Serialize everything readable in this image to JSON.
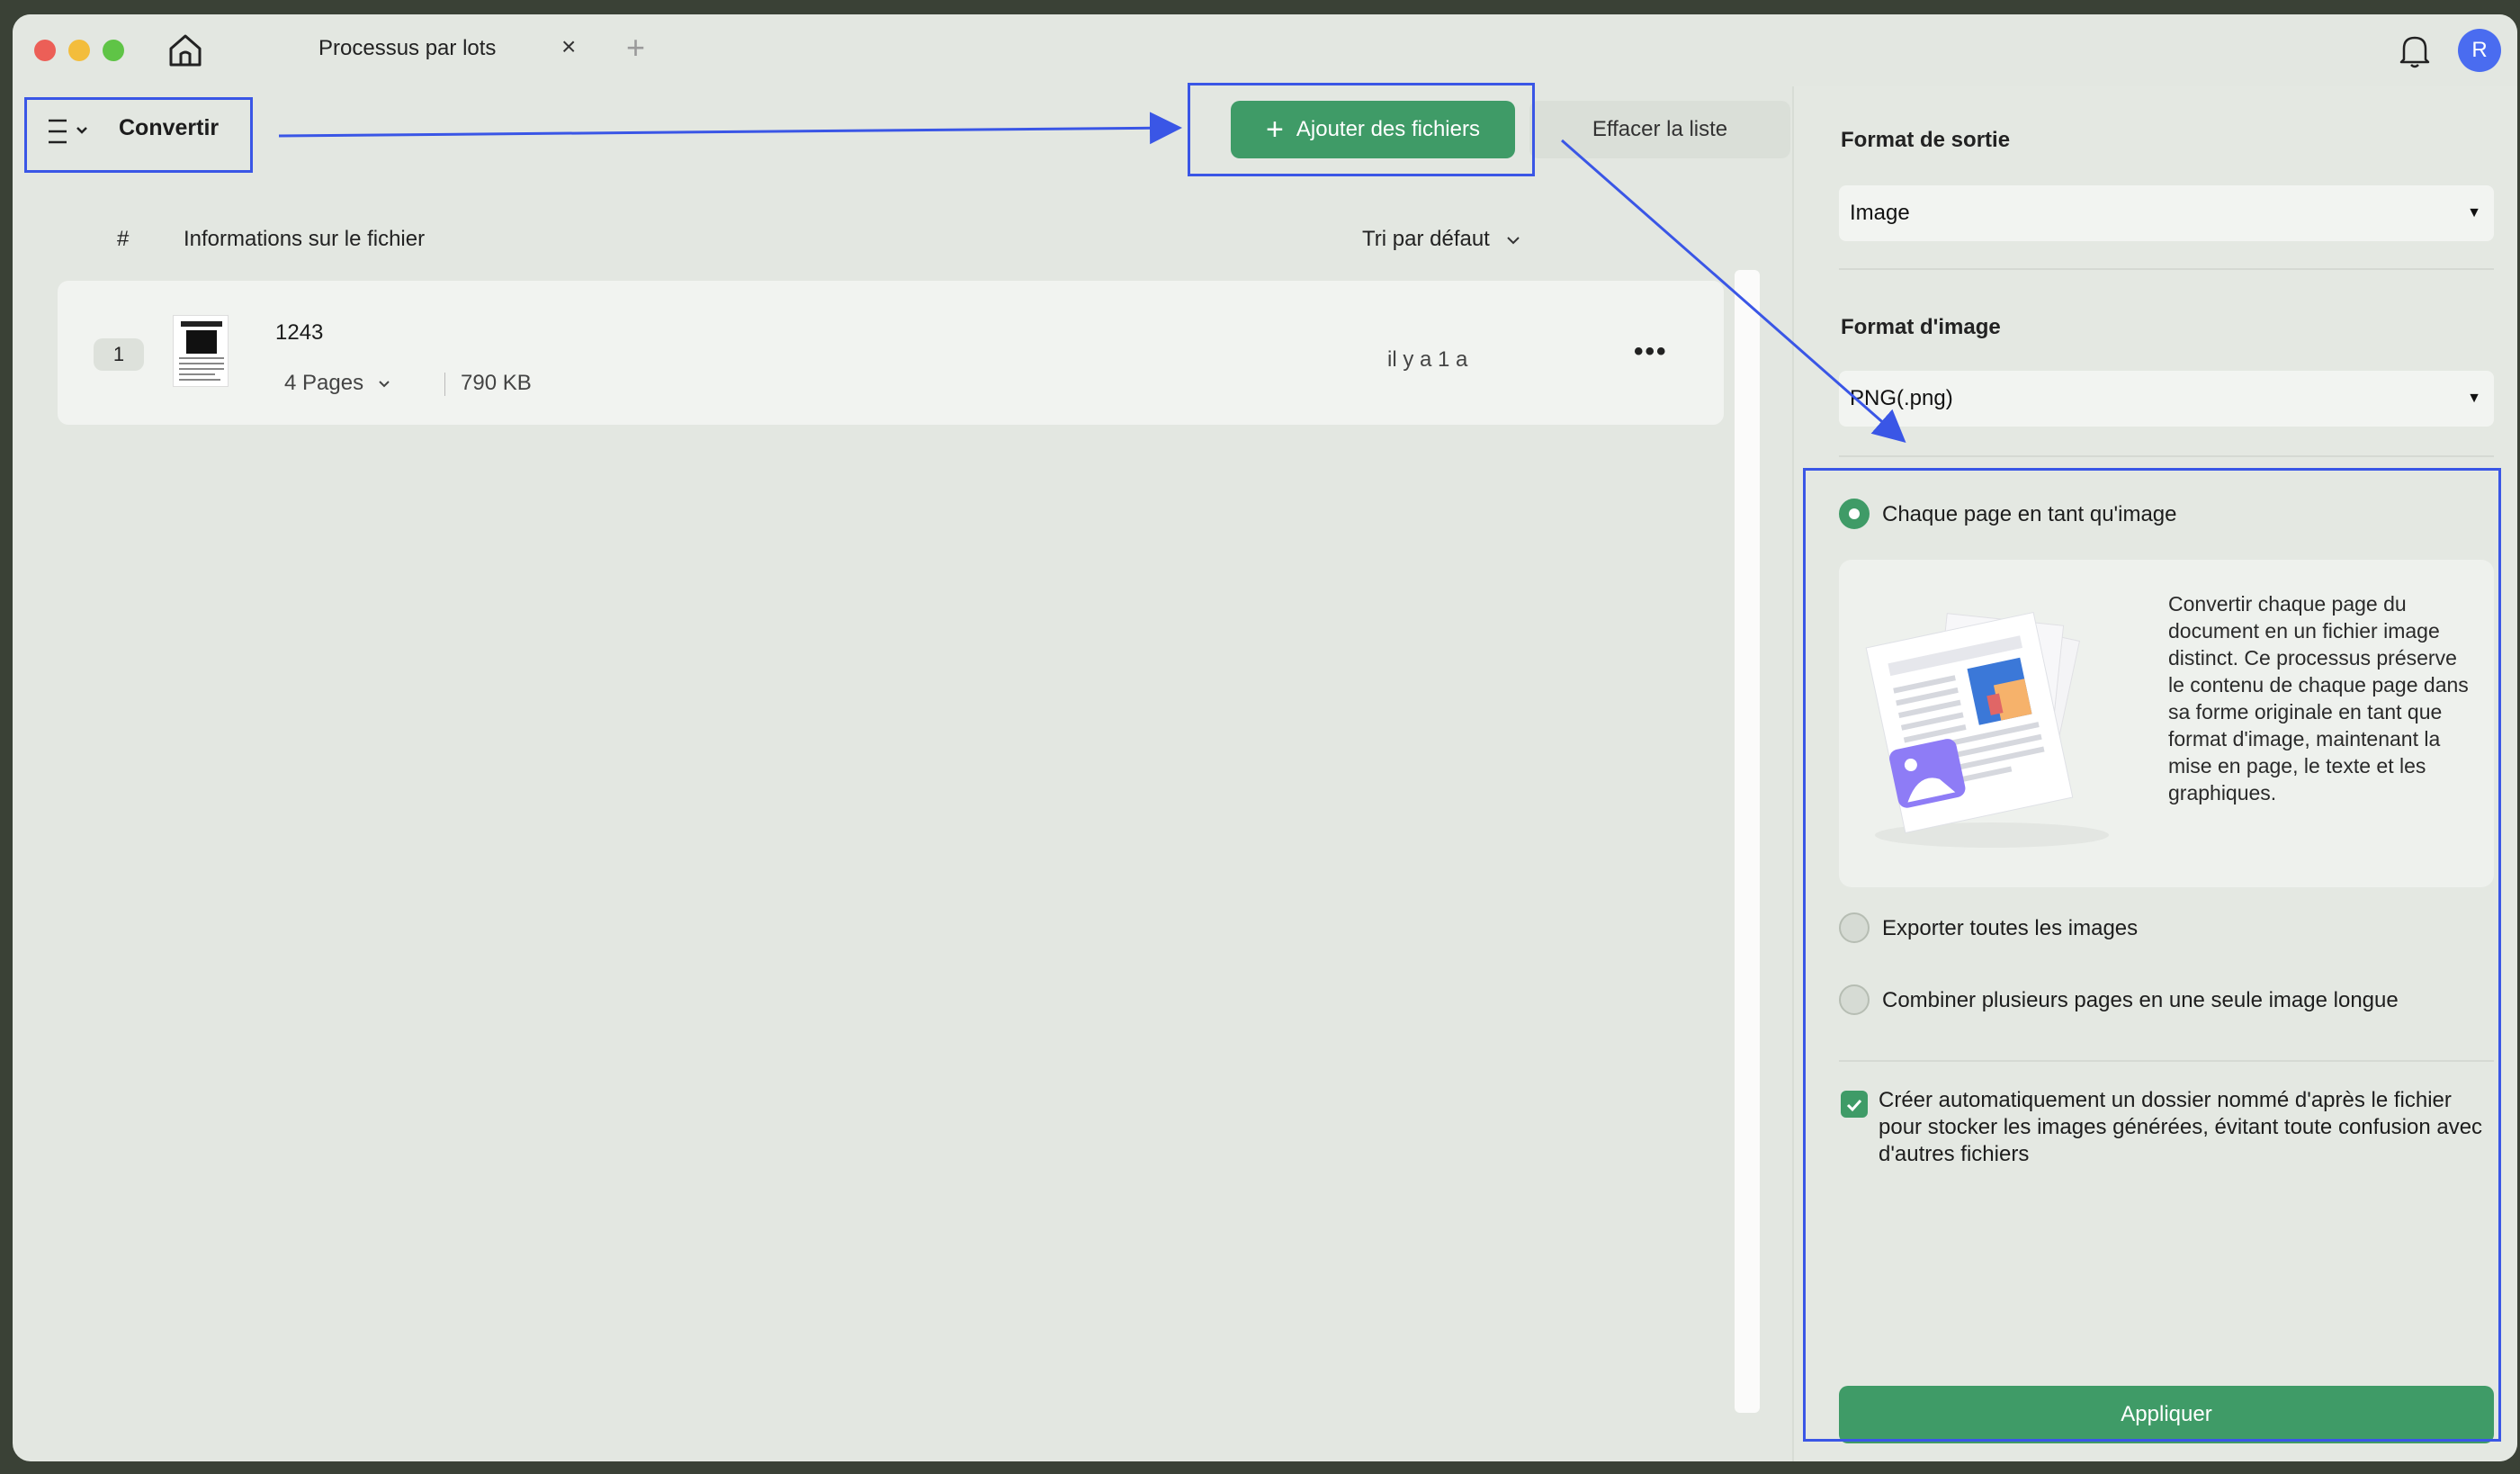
{
  "titlebar": {
    "tab_title": "Processus par lots",
    "tab_close": "×",
    "tab_add": "+",
    "avatar_initial": "R"
  },
  "toolbar": {
    "mode_title": "Convertir",
    "add_files_label": "Ajouter des fichiers",
    "add_files_icon": "+",
    "clear_list_label": "Effacer la liste"
  },
  "file_list": {
    "header_number": "#",
    "header_info": "Informations sur le fichier",
    "sort_label": "Tri par défaut",
    "rows": [
      {
        "index": "1",
        "name": "1243",
        "pages": "4 Pages",
        "size": "790 KB",
        "time": "il y a 1 a",
        "more": "•••"
      }
    ]
  },
  "panel": {
    "output_format_label": "Format de sortie",
    "output_format_value": "Image",
    "image_format_label": "Format d'image",
    "image_format_value": "PNG(.png)",
    "options": [
      {
        "label": "Chaque page en tant qu'image",
        "checked": true
      },
      {
        "label": "Exporter toutes les images",
        "checked": false
      },
      {
        "label": "Combiner plusieurs pages en une seule image longue",
        "checked": false
      }
    ],
    "description": "Convertir chaque page du document en un fichier image distinct. Ce processus préserve le contenu de chaque page dans sa forme originale en tant que format d'image, maintenant la mise en page, le texte et les graphiques.",
    "auto_folder_checked": true,
    "auto_folder_label": "Créer automatiquement un dossier nommé d'après le fichier pour stocker les images générées, évitant toute confusion avec d'autres fichiers",
    "apply_label": "Appliquer"
  },
  "colors": {
    "accent_green": "#3f9b67",
    "annotation_blue": "#3a56e6",
    "background": "#e3e7e1"
  },
  "icons": [
    "home-icon",
    "close-icon",
    "plus-icon",
    "bell-icon",
    "menu-icon",
    "chevron-down-icon",
    "more-icon",
    "caret-down-icon",
    "check-icon"
  ]
}
